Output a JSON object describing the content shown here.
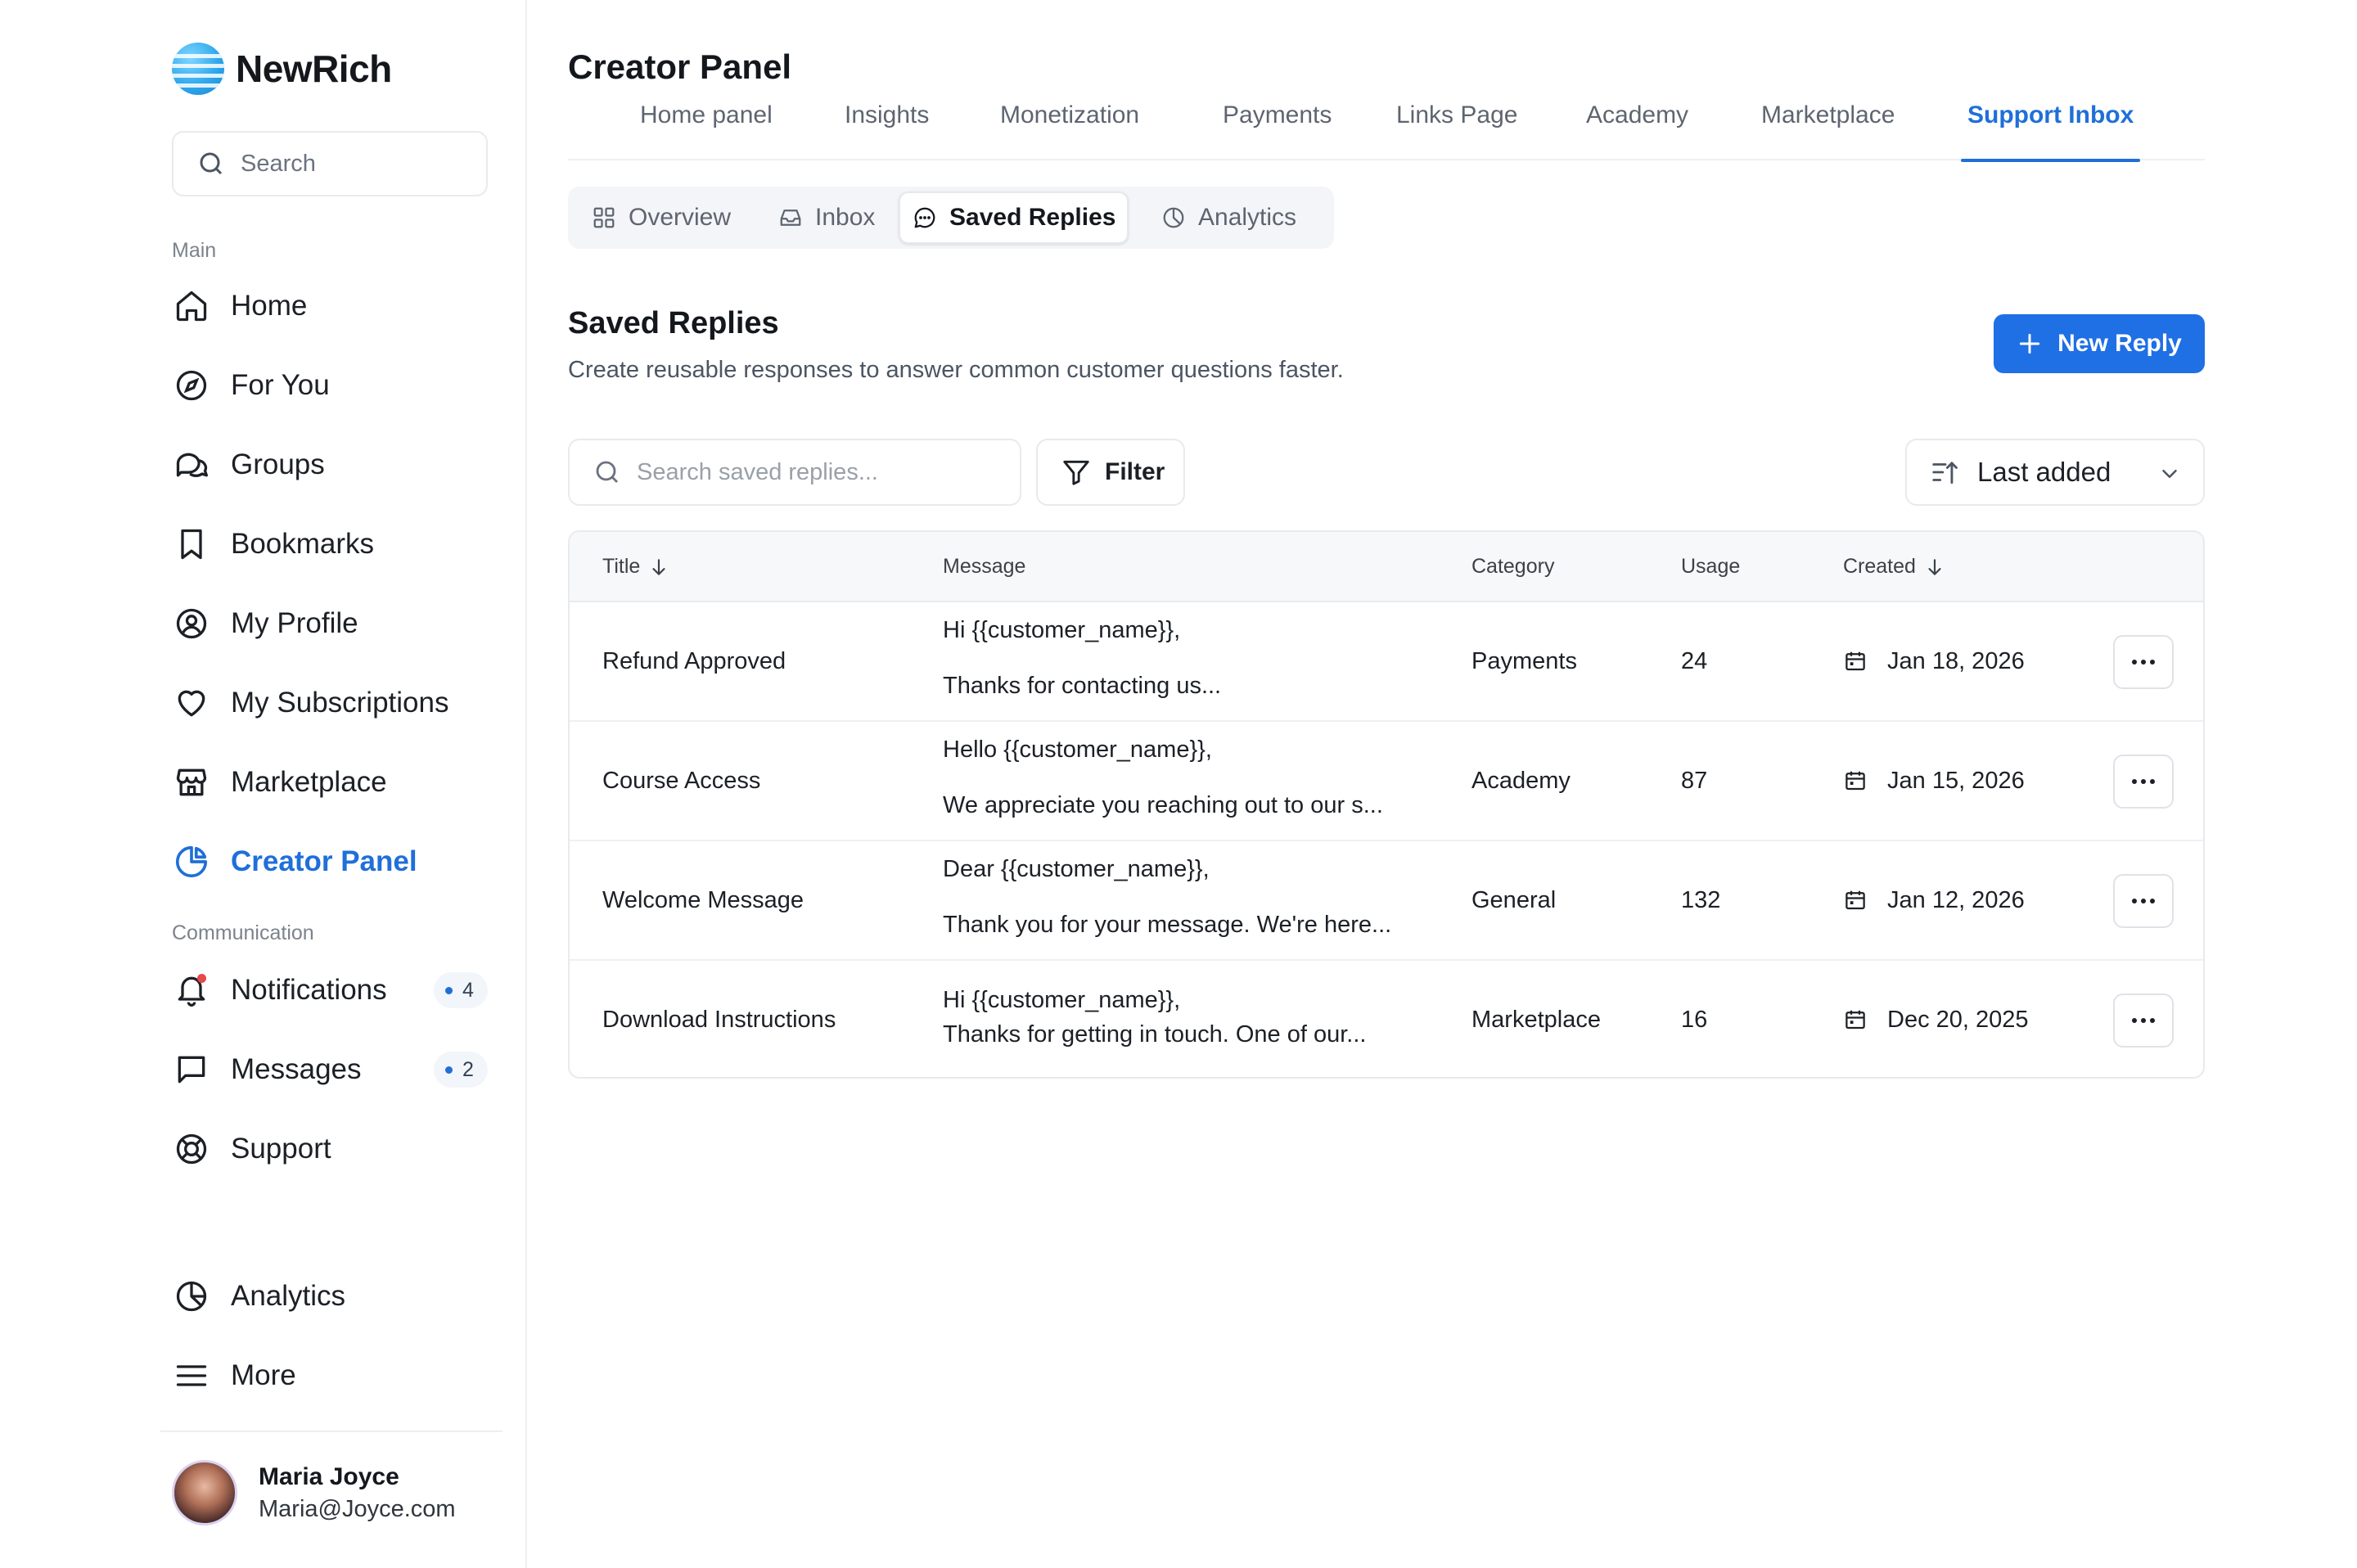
{
  "app": {
    "name": "NewRich"
  },
  "sidebar": {
    "search_placeholder": "Search",
    "main_label": "Main",
    "main_items": [
      {
        "label": "Home",
        "icon": "home-icon"
      },
      {
        "label": "For You",
        "icon": "compass-icon"
      },
      {
        "label": "Groups",
        "icon": "chat-bubbles-icon"
      },
      {
        "label": "Bookmarks",
        "icon": "bookmark-icon"
      },
      {
        "label": "My Profile",
        "icon": "user-circle-icon"
      },
      {
        "label": "My Subscriptions",
        "icon": "heart-icon"
      },
      {
        "label": "Marketplace",
        "icon": "store-icon"
      },
      {
        "label": "Creator Panel",
        "icon": "pie-chart-icon",
        "active": true
      }
    ],
    "communication_label": "Communication",
    "communication_items": [
      {
        "label": "Notifications",
        "icon": "bell-icon",
        "count": "4"
      },
      {
        "label": "Messages",
        "icon": "message-square-icon",
        "count": "2"
      },
      {
        "label": "Support",
        "icon": "lifebuoy-icon"
      }
    ],
    "bottom_items": [
      {
        "label": "Analytics",
        "icon": "pie-chart-icon"
      },
      {
        "label": "More",
        "icon": "menu-icon"
      }
    ],
    "user": {
      "name": "Maria Joyce",
      "email": "Maria@Joyce.com"
    }
  },
  "header": {
    "title": "Creator Panel",
    "tabs": [
      "Home panel",
      "Insights",
      "Monetization",
      "Payments",
      "Links Page",
      "Academy",
      "Marketplace",
      "Support Inbox"
    ],
    "active_tab": "Support Inbox"
  },
  "subtabs": [
    {
      "label": "Overview",
      "icon": "grid-icon"
    },
    {
      "label": "Inbox",
      "icon": "inbox-icon"
    },
    {
      "label": "Saved Replies",
      "icon": "chat-dots-icon",
      "active": true
    },
    {
      "label": "Analytics",
      "icon": "pie-chart-icon"
    }
  ],
  "content": {
    "title": "Saved Replies",
    "description": "Create reusable responses to answer common customer questions faster.",
    "new_button": "New Reply",
    "search_placeholder": "Search saved replies...",
    "filter_label": "Filter",
    "sort_label": "Last added"
  },
  "table": {
    "columns": [
      "Title",
      "Message",
      "Category",
      "Usage",
      "Created"
    ],
    "rows": [
      {
        "title": "Refund Approved",
        "message_line1": "Hi {{customer_name}},",
        "message_line2": "Thanks for contacting us...",
        "category": "Payments",
        "usage": "24",
        "created": "Jan 18, 2026"
      },
      {
        "title": "Course Access",
        "message_line1": "Hello {{customer_name}},",
        "message_line2": "We appreciate you reaching out to our s...",
        "category": "Academy",
        "usage": "87",
        "created": "Jan 15, 2026"
      },
      {
        "title": "Welcome Message",
        "message_line1": "Dear {{customer_name}},",
        "message_line2": "Thank you for your message. We're here...",
        "category": "General",
        "usage": "132",
        "created": "Jan 12, 2026"
      },
      {
        "title": "Download Instructions",
        "message_line1": "Hi {{customer_name}},",
        "message_line2": "Thanks for getting in touch. One of our...",
        "category": "Marketplace",
        "usage": "16",
        "created": "Dec 20, 2025"
      }
    ]
  },
  "colors": {
    "accent": "#1f6fd9",
    "button": "#1f6fe5",
    "notification_dot": "#e5484d"
  }
}
